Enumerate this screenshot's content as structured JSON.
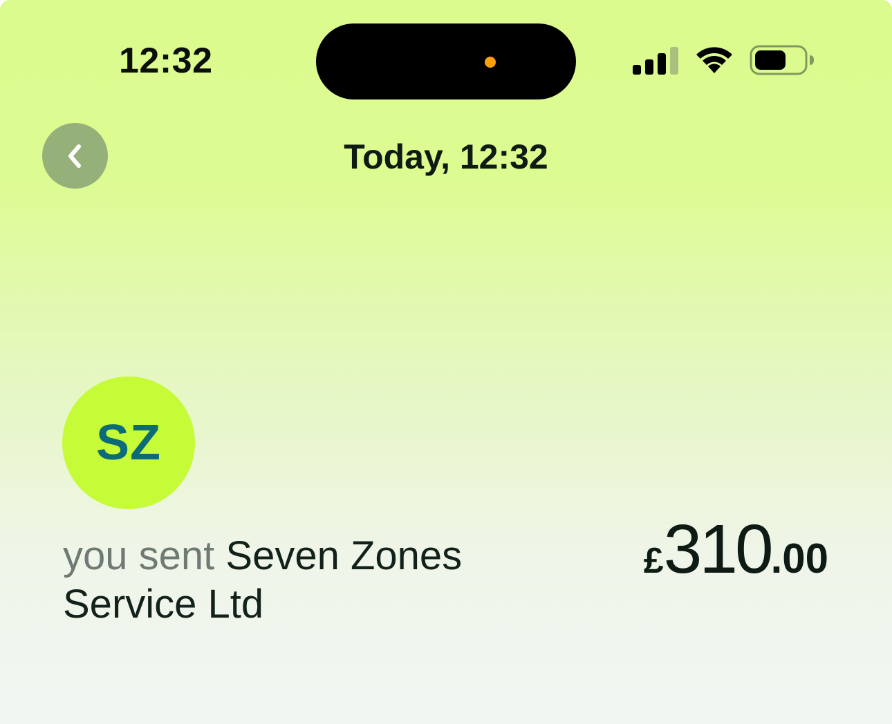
{
  "status_bar": {
    "time": "12:32",
    "icons": [
      "signal-icon",
      "wifi-icon",
      "battery-icon"
    ]
  },
  "header": {
    "title": "Today, 12:32",
    "back_icon": "chevron-left-icon"
  },
  "transaction": {
    "avatar_initials": "SZ",
    "prefix": "you sent",
    "recipient": "Seven Zones Service Ltd",
    "amount": {
      "currency": "£",
      "major": "310",
      "minor": ".00"
    }
  },
  "colors": {
    "background_top": "#dcfb8f",
    "background_bottom": "#f1f6f3",
    "avatar_bg": "#c6fb38",
    "avatar_text": "#0d6b78",
    "back_button_bg": "#96b07a",
    "island_dot": "#ff9f0a"
  }
}
